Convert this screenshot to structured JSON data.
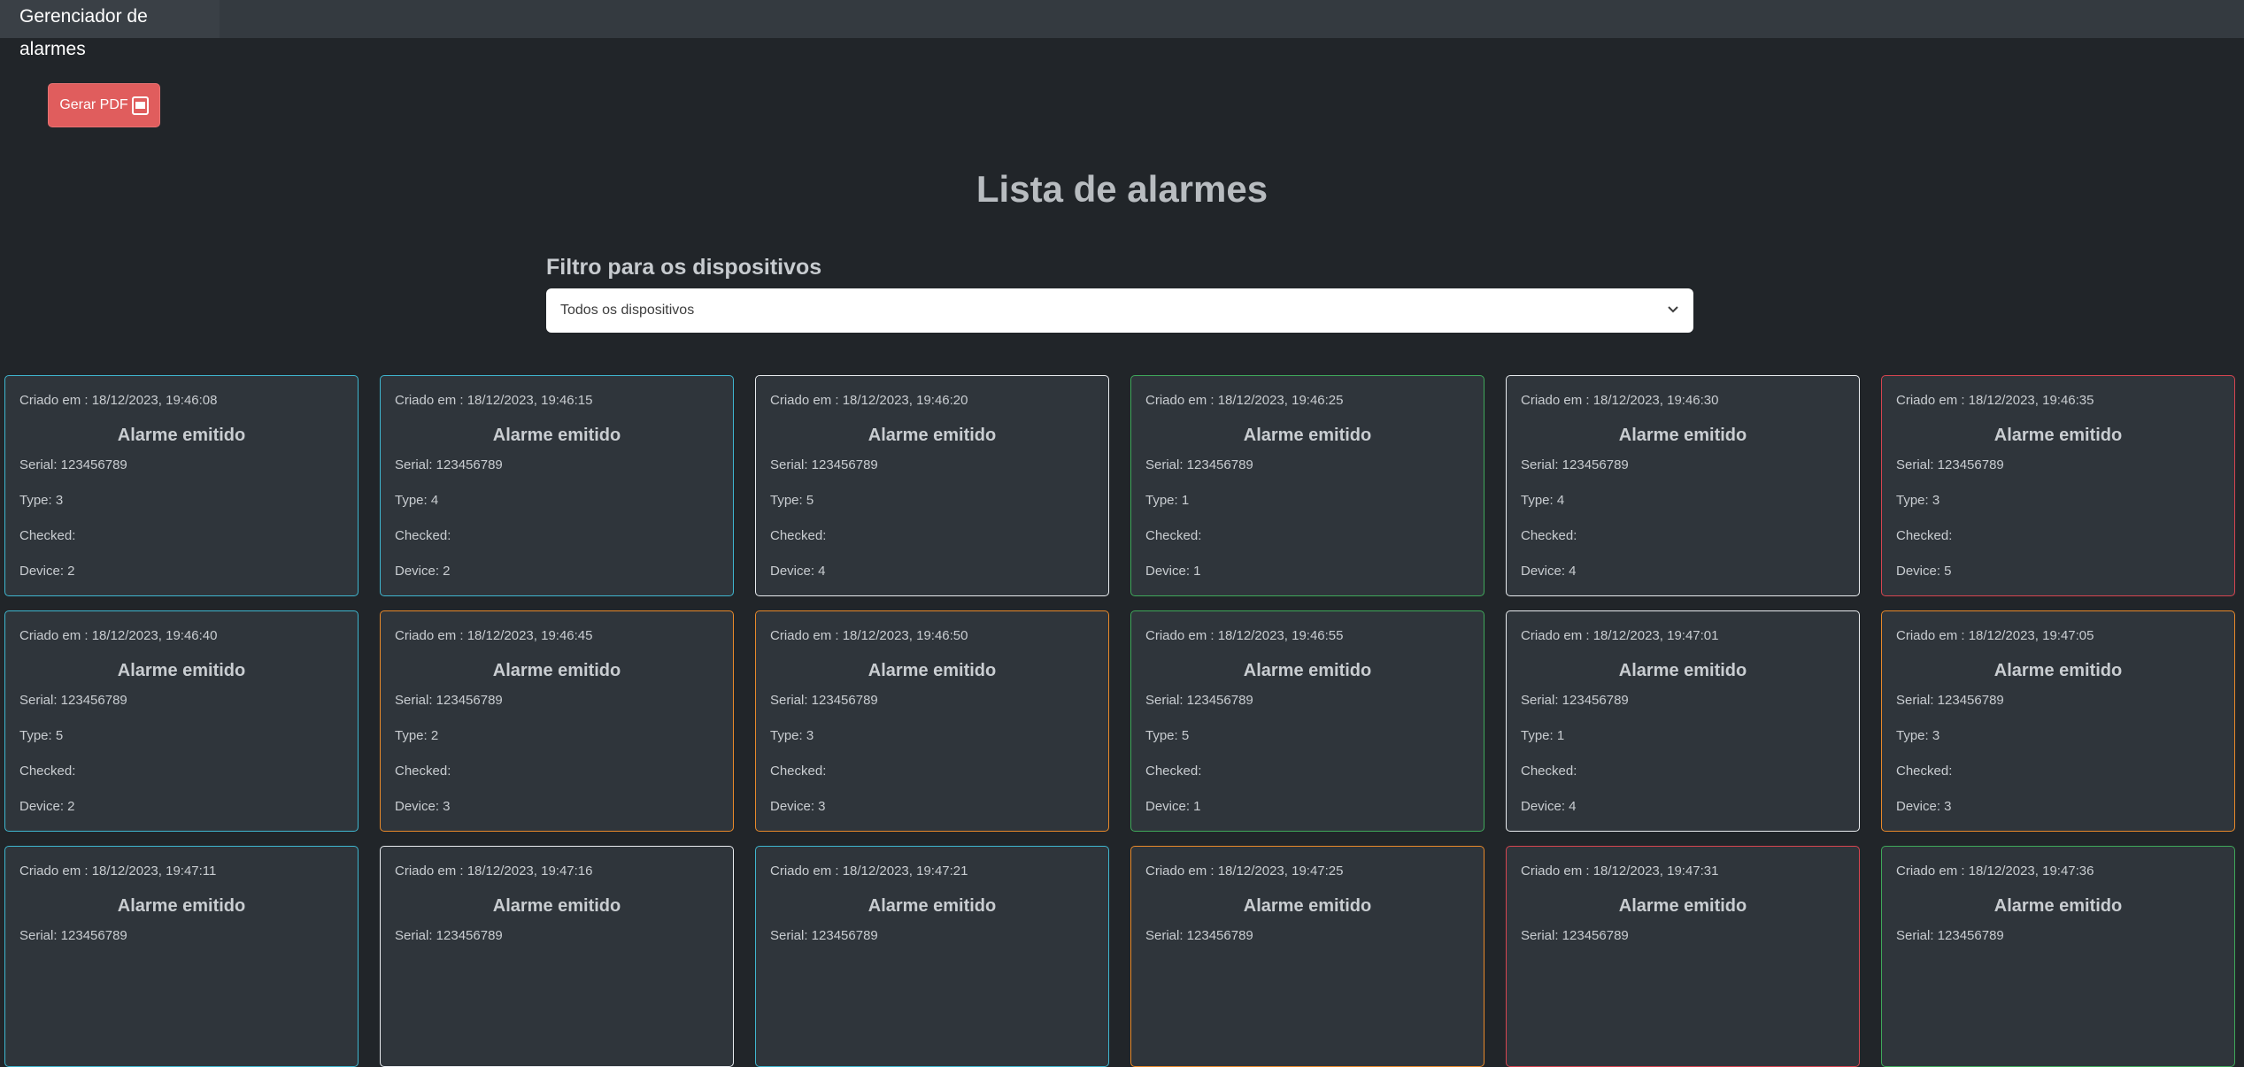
{
  "navbar": {
    "brand": "Gerenciador de alarmes"
  },
  "actions": {
    "pdf_label": "Gerar PDF",
    "pdf_icon": "pdf-file-icon"
  },
  "main": {
    "title": "Lista de alarmes",
    "filter_label": "Filtro para os dispositivos",
    "filter_value": "Todos os dispositivos"
  },
  "colors": {
    "cyan": "#3fb6cf",
    "white": "#e9ecef",
    "green": "#3fa85a",
    "red": "#d64550",
    "orange": "#e8892a"
  },
  "cards": [
    {
      "created": "Criado em : 18/12/2023, 19:46:08",
      "heading": "Alarme emitido",
      "serial": "Serial: 123456789",
      "type": "Type: 3",
      "checked": "Checked:",
      "device": "Device: 2",
      "color": "cyan"
    },
    {
      "created": "Criado em : 18/12/2023, 19:46:15",
      "heading": "Alarme emitido",
      "serial": "Serial: 123456789",
      "type": "Type: 4",
      "checked": "Checked:",
      "device": "Device: 2",
      "color": "cyan"
    },
    {
      "created": "Criado em : 18/12/2023, 19:46:20",
      "heading": "Alarme emitido",
      "serial": "Serial: 123456789",
      "type": "Type: 5",
      "checked": "Checked:",
      "device": "Device: 4",
      "color": "white"
    },
    {
      "created": "Criado em : 18/12/2023, 19:46:25",
      "heading": "Alarme emitido",
      "serial": "Serial: 123456789",
      "type": "Type: 1",
      "checked": "Checked:",
      "device": "Device: 1",
      "color": "green"
    },
    {
      "created": "Criado em : 18/12/2023, 19:46:30",
      "heading": "Alarme emitido",
      "serial": "Serial: 123456789",
      "type": "Type: 4",
      "checked": "Checked:",
      "device": "Device: 4",
      "color": "white"
    },
    {
      "created": "Criado em : 18/12/2023, 19:46:35",
      "heading": "Alarme emitido",
      "serial": "Serial: 123456789",
      "type": "Type: 3",
      "checked": "Checked:",
      "device": "Device: 5",
      "color": "red"
    },
    {
      "created": "Criado em : 18/12/2023, 19:46:40",
      "heading": "Alarme emitido",
      "serial": "Serial: 123456789",
      "type": "Type: 5",
      "checked": "Checked:",
      "device": "Device: 2",
      "color": "cyan"
    },
    {
      "created": "Criado em : 18/12/2023, 19:46:45",
      "heading": "Alarme emitido",
      "serial": "Serial: 123456789",
      "type": "Type: 2",
      "checked": "Checked:",
      "device": "Device: 3",
      "color": "orange"
    },
    {
      "created": "Criado em : 18/12/2023, 19:46:50",
      "heading": "Alarme emitido",
      "serial": "Serial: 123456789",
      "type": "Type: 3",
      "checked": "Checked:",
      "device": "Device: 3",
      "color": "orange"
    },
    {
      "created": "Criado em : 18/12/2023, 19:46:55",
      "heading": "Alarme emitido",
      "serial": "Serial: 123456789",
      "type": "Type: 5",
      "checked": "Checked:",
      "device": "Device: 1",
      "color": "green"
    },
    {
      "created": "Criado em : 18/12/2023, 19:47:01",
      "heading": "Alarme emitido",
      "serial": "Serial: 123456789",
      "type": "Type: 1",
      "checked": "Checked:",
      "device": "Device: 4",
      "color": "white"
    },
    {
      "created": "Criado em : 18/12/2023, 19:47:05",
      "heading": "Alarme emitido",
      "serial": "Serial: 123456789",
      "type": "Type: 3",
      "checked": "Checked:",
      "device": "Device: 3",
      "color": "orange"
    },
    {
      "created": "Criado em : 18/12/2023, 19:47:11",
      "heading": "Alarme emitido",
      "serial": "Serial: 123456789",
      "color": "cyan"
    },
    {
      "created": "Criado em : 18/12/2023, 19:47:16",
      "heading": "Alarme emitido",
      "serial": "Serial: 123456789",
      "color": "white"
    },
    {
      "created": "Criado em : 18/12/2023, 19:47:21",
      "heading": "Alarme emitido",
      "serial": "Serial: 123456789",
      "color": "cyan"
    },
    {
      "created": "Criado em : 18/12/2023, 19:47:25",
      "heading": "Alarme emitido",
      "serial": "Serial: 123456789",
      "color": "orange"
    },
    {
      "created": "Criado em : 18/12/2023, 19:47:31",
      "heading": "Alarme emitido",
      "serial": "Serial: 123456789",
      "color": "red"
    },
    {
      "created": "Criado em : 18/12/2023, 19:47:36",
      "heading": "Alarme emitido",
      "serial": "Serial: 123456789",
      "color": "green"
    }
  ]
}
